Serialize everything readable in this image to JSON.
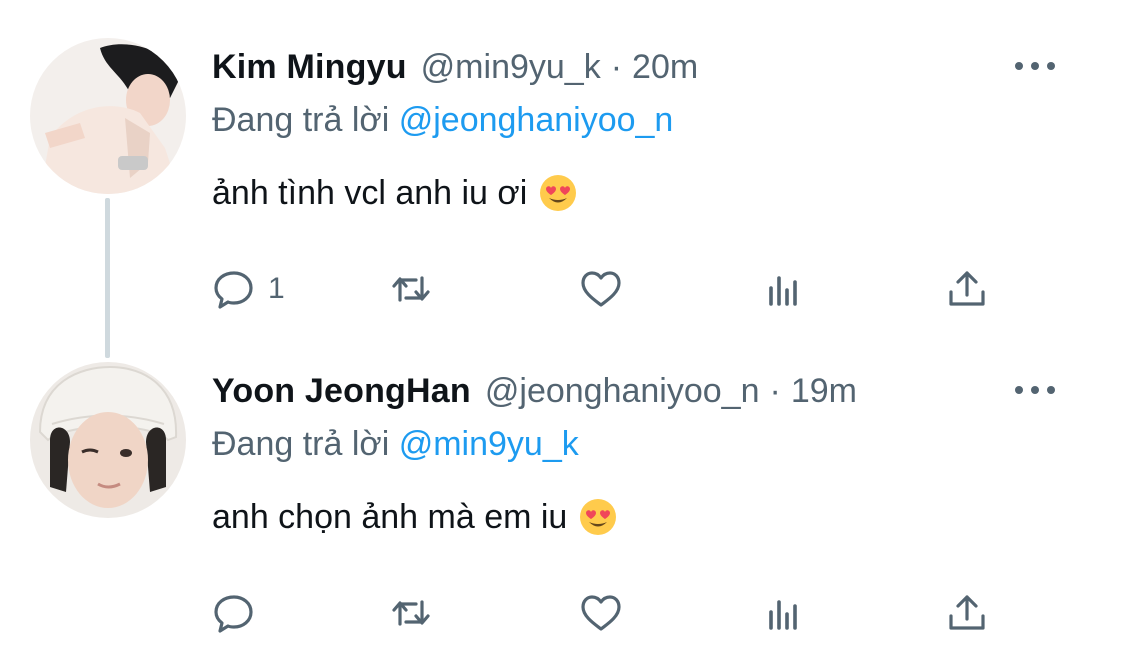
{
  "colors": {
    "text": "#0f1419",
    "secondary": "#536471",
    "link": "#1d9bf0",
    "thread_line": "#cfd9de"
  },
  "tweets": [
    {
      "name": "Kim Mingyu",
      "handle": "@min9yu_k",
      "separator": "·",
      "time": "20m",
      "replying_prefix": "Đang trả lời",
      "replying_to": "@jeonghaniyoo_n",
      "text": "ảnh tình vcl anh iu ơi",
      "emoji": "heart-eyes-emoji",
      "reply_count": "1",
      "avatar": "profile-photo"
    },
    {
      "name": "Yoon JeongHan",
      "handle": "@jeonghaniyoo_n",
      "separator": "·",
      "time": "19m",
      "replying_prefix": "Đang trả lời",
      "replying_to": "@min9yu_k",
      "text": "anh chọn ảnh mà em iu",
      "emoji": "heart-eyes-emoji",
      "reply_count": "",
      "avatar": "profile-photo"
    }
  ],
  "action_icons": [
    "reply-icon",
    "retweet-icon",
    "like-icon",
    "stats-icon",
    "share-icon"
  ]
}
